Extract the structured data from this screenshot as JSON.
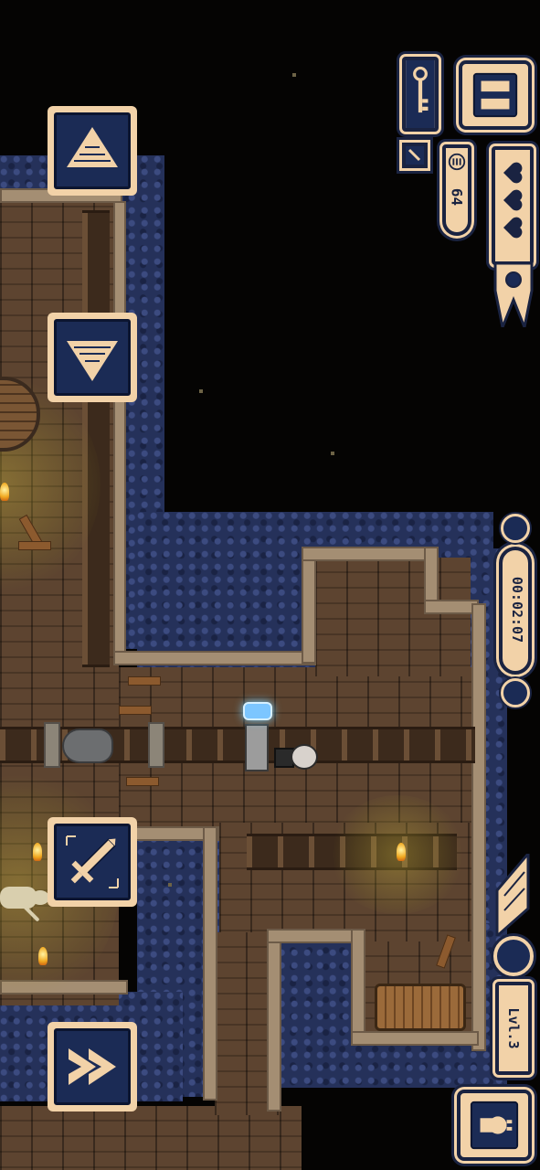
{
  "hud": {
    "timer": "00:02:07",
    "level_label": "Lvl.3",
    "coins": "64",
    "hearts_filled": 3,
    "hearts_total": 3,
    "has_key": true
  },
  "controls": {
    "up": "up-arrow-icon",
    "down": "down-arrow-icon",
    "attack": "sword-icon",
    "dash": "double-chevron-icon",
    "pause": "pause-icon",
    "character": "character-portrait-icon"
  },
  "colors": {
    "panel": "#f2d2a8",
    "panel_border": "#1a2341",
    "button_face": "#1b2b55",
    "floor": "#5d4430",
    "wall_stone": "#25315a"
  }
}
